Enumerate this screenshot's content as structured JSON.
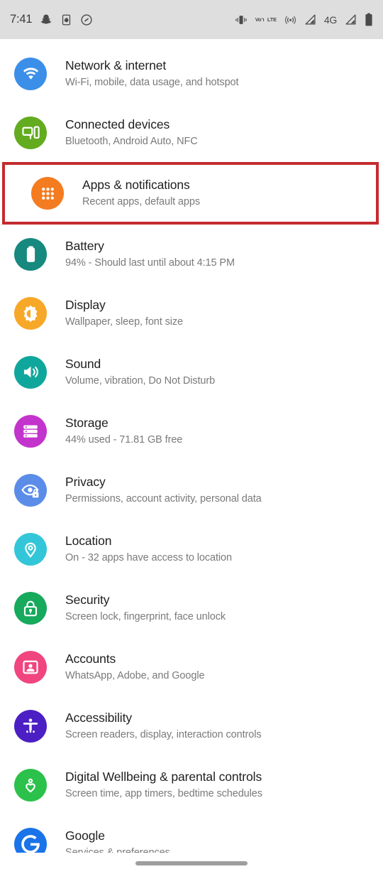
{
  "status_bar": {
    "time": "7:41",
    "left_icons": [
      {
        "name": "snapchat-icon"
      },
      {
        "name": "screen-record-icon"
      },
      {
        "name": "shazam-icon"
      }
    ],
    "right_icons": [
      {
        "name": "vibrate-icon"
      },
      {
        "name": "volte-icon",
        "label_top": "VoՈ",
        "label_bottom": "LTE"
      },
      {
        "name": "hotspot-icon"
      },
      {
        "name": "signal-bars-sim1-icon"
      },
      {
        "name": "network-type-label",
        "label": "4G"
      },
      {
        "name": "signal-bars-sim2-icon"
      },
      {
        "name": "battery-icon"
      }
    ],
    "background": "#dedede"
  },
  "highlight": {
    "color": "#c42b2f",
    "target_index": 2
  },
  "settings": {
    "items": [
      {
        "id": "network-internet",
        "title": "Network & internet",
        "subtitle": "Wi-Fi, mobile, data usage, and hotspot",
        "icon": "wifi-icon",
        "icon_color": "#3b8fe8",
        "highlighted": false
      },
      {
        "id": "connected-devices",
        "title": "Connected devices",
        "subtitle": "Bluetooth, Android Auto, NFC",
        "icon": "devices-icon",
        "icon_color": "#63ab1f",
        "highlighted": false
      },
      {
        "id": "apps-notifications",
        "title": "Apps & notifications",
        "subtitle": "Recent apps, default apps",
        "icon": "apps-grid-icon",
        "icon_color": "#f47b20",
        "highlighted": true
      },
      {
        "id": "battery",
        "title": "Battery",
        "subtitle": "94% - Should last until about 4:15 PM",
        "icon": "battery-icon",
        "icon_color": "#17897f",
        "highlighted": false
      },
      {
        "id": "display",
        "title": "Display",
        "subtitle": "Wallpaper, sleep, font size",
        "icon": "brightness-icon",
        "icon_color": "#f7a828",
        "highlighted": false
      },
      {
        "id": "sound",
        "title": "Sound",
        "subtitle": "Volume, vibration, Do Not Disturb",
        "icon": "speaker-icon",
        "icon_color": "#0fa79b",
        "highlighted": false
      },
      {
        "id": "storage",
        "title": "Storage",
        "subtitle": "44% used - 71.81 GB free",
        "icon": "storage-icon",
        "icon_color": "#c334cc",
        "highlighted": false
      },
      {
        "id": "privacy",
        "title": "Privacy",
        "subtitle": "Permissions, account activity, personal data",
        "icon": "privacy-eye-icon",
        "icon_color": "#5b8de8",
        "highlighted": false
      },
      {
        "id": "location",
        "title": "Location",
        "subtitle": "On - 32 apps have access to location",
        "icon": "location-pin-icon",
        "icon_color": "#33c6d8",
        "highlighted": false
      },
      {
        "id": "security",
        "title": "Security",
        "subtitle": "Screen lock, fingerprint, face unlock",
        "icon": "lock-icon",
        "icon_color": "#17a95c",
        "highlighted": false
      },
      {
        "id": "accounts",
        "title": "Accounts",
        "subtitle": "WhatsApp, Adobe, and Google",
        "icon": "account-card-icon",
        "icon_color": "#f0457f",
        "highlighted": false
      },
      {
        "id": "accessibility",
        "title": "Accessibility",
        "subtitle": "Screen readers, display, interaction controls",
        "icon": "accessibility-icon",
        "icon_color": "#4b1fc4",
        "highlighted": false
      },
      {
        "id": "digital-wellbeing",
        "title": "Digital Wellbeing & parental controls",
        "subtitle": "Screen time, app timers, bedtime schedules",
        "icon": "wellbeing-heart-icon",
        "icon_color": "#2bc14b",
        "highlighted": false
      },
      {
        "id": "google",
        "title": "Google",
        "subtitle": "Services & preferences",
        "icon": "google-g-icon",
        "icon_color": "#1a73e8",
        "highlighted": false
      }
    ]
  },
  "nav_bar": {
    "handle": "gesture-handle"
  }
}
